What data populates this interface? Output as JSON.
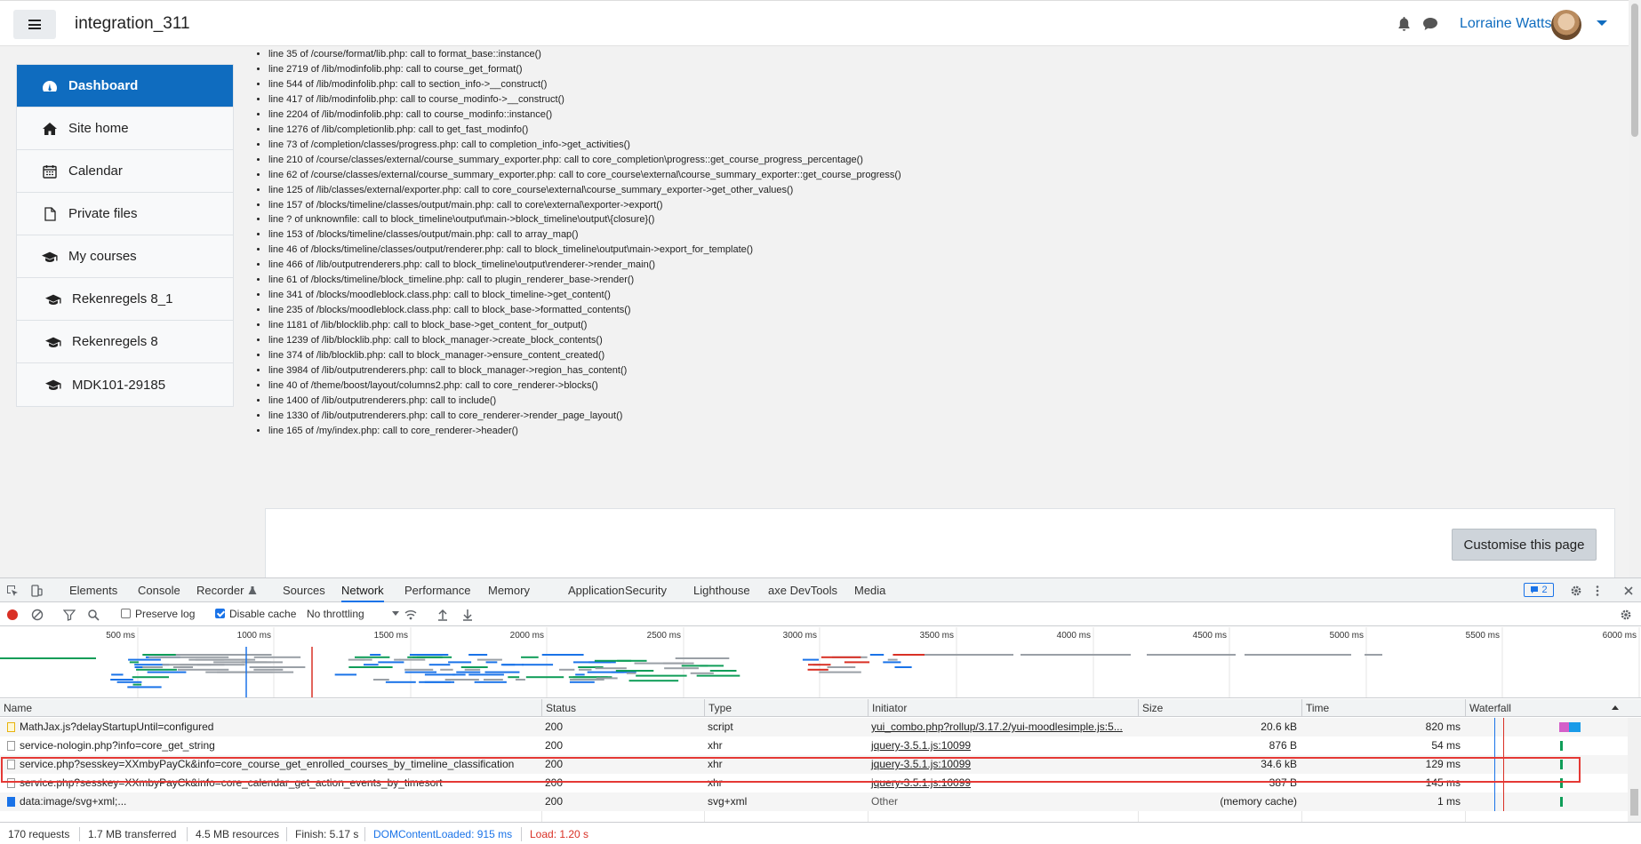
{
  "navbar": {
    "site_name": "integration_311",
    "user_name": "Lorraine Watts"
  },
  "drawer": {
    "items": [
      {
        "label": "Dashboard",
        "icon": "dashboard-icon"
      },
      {
        "label": "Site home",
        "icon": "home-icon"
      },
      {
        "label": "Calendar",
        "icon": "calendar-icon"
      },
      {
        "label": "Private files",
        "icon": "file-icon"
      },
      {
        "label": "My courses",
        "icon": "graduation-cap-icon"
      },
      {
        "label": "Rekenregels 8_1",
        "icon": "graduation-cap-icon"
      },
      {
        "label": "Rekenregels 8",
        "icon": "graduation-cap-icon"
      },
      {
        "label": "MDK101-29185",
        "icon": "graduation-cap-icon"
      }
    ]
  },
  "trace": [
    "line 35 of /course/format/lib.php: call to format_base::instance()",
    "line 2719 of /lib/modinfolib.php: call to course_get_format()",
    "line 544 of /lib/modinfolib.php: call to section_info->__construct()",
    "line 417 of /lib/modinfolib.php: call to course_modinfo->__construct()",
    "line 2204 of /lib/modinfolib.php: call to course_modinfo::instance()",
    "line 1276 of /lib/completionlib.php: call to get_fast_modinfo()",
    "line 73 of /completion/classes/progress.php: call to completion_info->get_activities()",
    "line 210 of /course/classes/external/course_summary_exporter.php: call to core_completion\\progress::get_course_progress_percentage()",
    "line 62 of /course/classes/external/course_summary_exporter.php: call to core_course\\external\\course_summary_exporter::get_course_progress()",
    "line 125 of /lib/classes/external/exporter.php: call to core_course\\external\\course_summary_exporter->get_other_values()",
    "line 157 of /blocks/timeline/classes/output/main.php: call to core\\external\\exporter->export()",
    "line ? of unknownfile: call to block_timeline\\output\\main->block_timeline\\output\\{closure}()",
    "line 153 of /blocks/timeline/classes/output/main.php: call to array_map()",
    "line 46 of /blocks/timeline/classes/output/renderer.php: call to block_timeline\\output\\main->export_for_template()",
    "line 466 of /lib/outputrenderers.php: call to block_timeline\\output\\renderer->render_main()",
    "line 61 of /blocks/timeline/block_timeline.php: call to plugin_renderer_base->render()",
    "line 341 of /blocks/moodleblock.class.php: call to block_timeline->get_content()",
    "line 235 of /blocks/moodleblock.class.php: call to block_base->formatted_contents()",
    "line 1181 of /lib/blocklib.php: call to block_base->get_content_for_output()",
    "line 1239 of /lib/blocklib.php: call to block_manager->create_block_contents()",
    "line 374 of /lib/blocklib.php: call to block_manager->ensure_content_created()",
    "line 3984 of /lib/outputrenderers.php: call to block_manager->region_has_content()",
    "line 40 of /theme/boost/layout/columns2.php: call to core_renderer->blocks()",
    "line 1400 of /lib/outputrenderers.php: call to include()",
    "line 1330 of /lib/outputrenderers.php: call to core_renderer->render_page_layout()",
    "line 165 of /my/index.php: call to core_renderer->header()"
  ],
  "customise_label": "Customise this page",
  "devtools": {
    "tabs": [
      "Elements",
      "Console",
      "Recorder",
      "Sources",
      "Network",
      "Performance",
      "Memory",
      "Application",
      "Security",
      "Lighthouse",
      "axe DevTools",
      "Media"
    ],
    "active_tab": "Network",
    "issues_count": "2",
    "toolbar": {
      "preserve_log": "Preserve log",
      "preserve_log_checked": false,
      "disable_cache": "Disable cache",
      "disable_cache_checked": true,
      "throttling": "No throttling"
    },
    "timeline_ticks": [
      "500 ms",
      "1000 ms",
      "1500 ms",
      "2000 ms",
      "2500 ms",
      "3000 ms",
      "3500 ms",
      "4000 ms",
      "4500 ms",
      "5000 ms",
      "5500 ms",
      "6000 ms"
    ],
    "columns": [
      "Name",
      "Status",
      "Type",
      "Initiator",
      "Size",
      "Time",
      "Waterfall"
    ],
    "rows": [
      {
        "name": "MathJax.js?delayStartupUntil=configured",
        "file": "js",
        "status": "200",
        "type": "script",
        "initiator": "yui_combo.php?rollup/3.17.2/yui-moodlesimple.js:5...",
        "initiator_link": true,
        "size": "20.6 kB",
        "time": "820 ms"
      },
      {
        "name": "service-nologin.php?info=core_get_string",
        "file": "doc",
        "status": "200",
        "type": "xhr",
        "initiator": "jquery-3.5.1.js:10099",
        "initiator_link": true,
        "size": "876 B",
        "time": "54 ms"
      },
      {
        "name": "service.php?sesskey=XXmbyPayCk&info=core_course_get_enrolled_courses_by_timeline_classification",
        "file": "doc",
        "status": "200",
        "type": "xhr",
        "initiator": "jquery-3.5.1.js:10099",
        "initiator_link": true,
        "size": "34.6 kB",
        "time": "129 ms"
      },
      {
        "name": "service.php?sesskey=XXmbyPayCk&info=core_calendar_get_action_events_by_timesort",
        "file": "doc",
        "status": "200",
        "type": "xhr",
        "initiator": "jquery-3.5.1.js:10099",
        "initiator_link": true,
        "size": "387 B",
        "time": "145 ms"
      },
      {
        "name": "data:image/svg+xml;...",
        "file": "img",
        "status": "200",
        "type": "svg+xml",
        "initiator": "Other",
        "initiator_link": false,
        "size": "(memory cache)",
        "time": "1 ms"
      }
    ],
    "status_bar": {
      "requests": "170 requests",
      "transferred": "1.7 MB transferred",
      "resources": "4.5 MB resources",
      "finish": "Finish: 5.17 s",
      "dom_content_loaded": "DOMContentLoaded: 915 ms",
      "load": "Load: 1.20 s"
    },
    "colors": {
      "dcl": "#1a73e8",
      "load": "#d93025",
      "accent": "#1a73e8"
    }
  }
}
